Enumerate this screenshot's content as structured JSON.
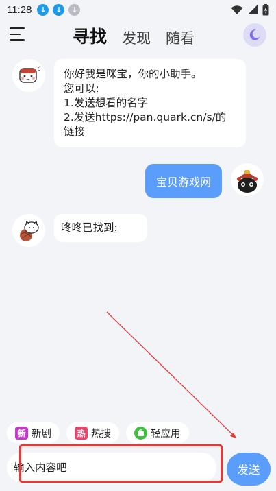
{
  "status_bar": {
    "time": "11:28",
    "download_icons": [
      "download-icon",
      "download-icon",
      "download-icon"
    ]
  },
  "header": {
    "tabs": [
      {
        "label": "寻找",
        "active": true
      },
      {
        "label": "发现",
        "active": false
      },
      {
        "label": "随看",
        "active": false
      }
    ],
    "theme_icon": "moon-icon"
  },
  "chat": {
    "messages": [
      {
        "from": "bot",
        "lines": [
          "你好我是咪宝，你的小助手。",
          "您可以:",
          "1.发送想看的名字",
          "2.发送https://pan.quark.cn/s/的",
          "链接"
        ]
      },
      {
        "from": "user",
        "text": "宝贝游戏网"
      },
      {
        "from": "bot",
        "text": "咚咚已找到:"
      }
    ]
  },
  "quick_chips": [
    {
      "badge": "新",
      "label": "新剧",
      "color": "#c23ac9"
    },
    {
      "badge": "热",
      "label": "热搜",
      "color": "#e8456d"
    },
    {
      "badge": "▣",
      "label": "轻应用",
      "color": "#3fbf3f"
    }
  ],
  "composer": {
    "input_value": "输入内容吧",
    "send_label": "发送"
  },
  "colors": {
    "accent": "#5b9dfa",
    "background": "#f3f4f8",
    "highlight": "#e53935"
  }
}
